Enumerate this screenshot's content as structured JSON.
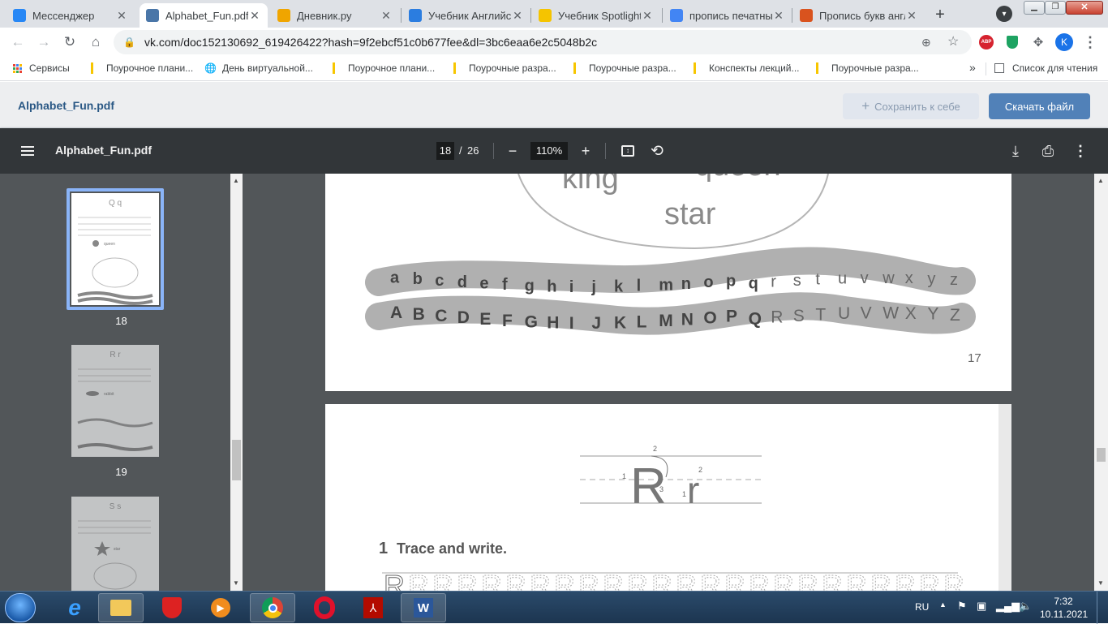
{
  "browser": {
    "tabs": [
      {
        "label": "Мессенджер",
        "favicon": "vk-messenger-icon",
        "color": "#2787f5"
      },
      {
        "label": "Alphabet_Fun.pdf",
        "favicon": "vk-icon",
        "color": "#4a76a8"
      },
      {
        "label": "Дневник.ру",
        "favicon": "dnevnik-icon",
        "color": "#f0a500"
      },
      {
        "label": "Учебник Английского",
        "favicon": "vk-b-icon",
        "color": "#2b7de0"
      },
      {
        "label": "Учебник Spotlight",
        "favicon": "bookmark-icon",
        "color": "#f5c400"
      },
      {
        "label": "пропись печатных",
        "favicon": "google-icon",
        "color": "#4285f4"
      },
      {
        "label": "Пропись букв англ",
        "favicon": "ball-icon",
        "color": "#d9531e"
      }
    ],
    "url": "vk.com/doc152130692_619426422?hash=9f2ebcf51c0b677fee&dl=3bc6eaa6e2c5048b2c",
    "profile_initial": "K",
    "abp_label": "ABP",
    "bookmarks": {
      "apps": "Сервисы",
      "items": [
        "Поурочное плани...",
        "День виртуальной...",
        "Поурочное плани...",
        "Поурочные разра...",
        "Поурочные разра...",
        "Конспекты лекций...",
        "Поурочные разра..."
      ],
      "overflow": "»",
      "reading_list": "Список для чтения"
    }
  },
  "vk": {
    "doc_title": "Alphabet_Fun.pdf",
    "save_label": "Сохранить к себе",
    "download_label": "Скачать файл"
  },
  "pdf": {
    "title": "Alphabet_Fun.pdf",
    "current_page": "18",
    "page_sep": "/",
    "total_pages": "26",
    "zoom": "110%",
    "thumbnails": [
      {
        "page": "18",
        "title": "Q q",
        "word": "queen",
        "selected": true
      },
      {
        "page": "19",
        "title": "R r",
        "word": "rabbit",
        "selected": false
      },
      {
        "page": "20",
        "title": "S s",
        "word": "star",
        "selected": false
      }
    ],
    "page17": {
      "words": [
        "king",
        "queen",
        "star"
      ],
      "lower": [
        "a",
        "b",
        "c",
        "d",
        "e",
        "f",
        "g",
        "h",
        "i",
        "j",
        "k",
        "l",
        "m",
        "n",
        "o",
        "p",
        "q",
        "r",
        "s",
        "t",
        "u",
        "v",
        "w",
        "x",
        "y",
        "z"
      ],
      "upper": [
        "A",
        "B",
        "C",
        "D",
        "E",
        "F",
        "G",
        "H",
        "I",
        "J",
        "K",
        "L",
        "M",
        "N",
        "O",
        "P",
        "Q",
        "R",
        "S",
        "T",
        "U",
        "V",
        "W",
        "X",
        "Y",
        "Z"
      ],
      "page_number": "17"
    },
    "page18": {
      "letter_upper": "R",
      "letter_lower": "r",
      "stroke_numbers": [
        "1",
        "2",
        "3",
        "1",
        "2"
      ],
      "exercise_number": "1",
      "exercise_title": "Trace and write.",
      "trace_letter": "R"
    }
  },
  "taskbar": {
    "lang": "RU",
    "time": "7:32",
    "date": "10.11.2021"
  }
}
